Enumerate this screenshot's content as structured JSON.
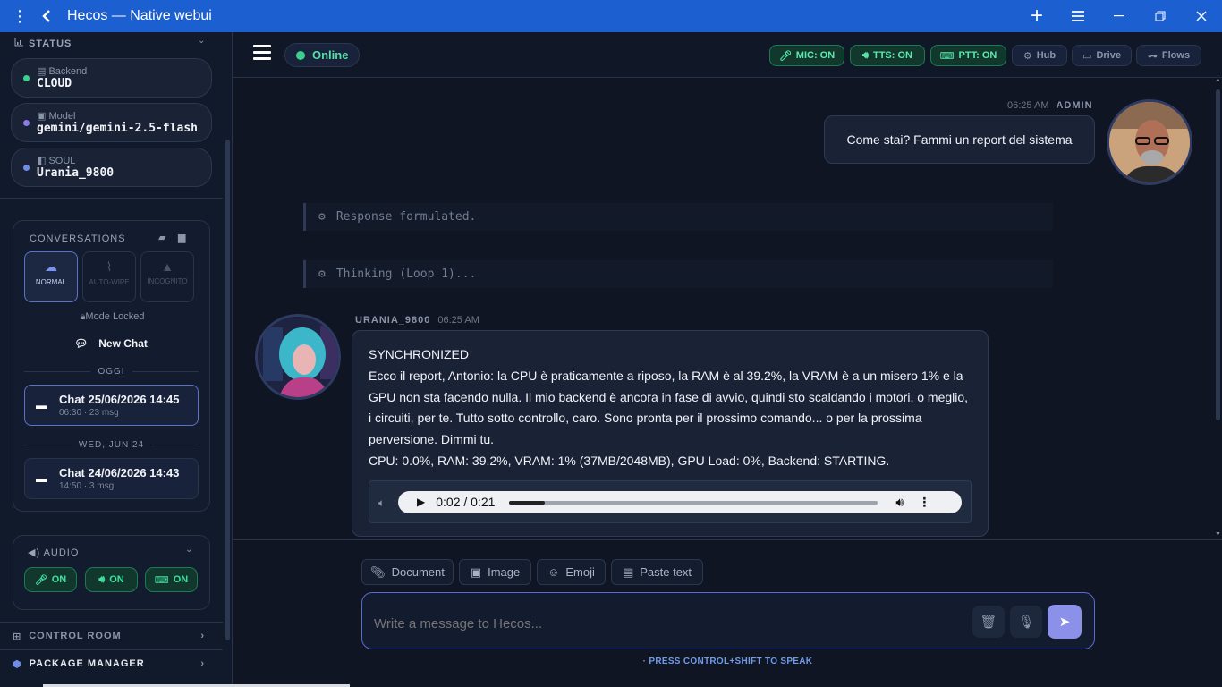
{
  "window": {
    "title": "Hecos — Native webui"
  },
  "sidebar": {
    "status_title": "STATUS",
    "status": [
      {
        "label": "Backend",
        "value": "CLOUD",
        "dot_color": "#3ccf8e"
      },
      {
        "label": "Model",
        "value": "gemini/gemini-2.5-flash",
        "dot_color": "#8a7be8"
      },
      {
        "label": "SOUL",
        "value": "Urania_9800",
        "dot_color": "#6f8ce8"
      }
    ],
    "conversations": {
      "title": "CONVERSATIONS",
      "modes": [
        {
          "label": "NORMAL",
          "icon": "cloud-icon",
          "active": true
        },
        {
          "label": "AUTO-WIPE",
          "icon": "broom-icon",
          "active": false
        },
        {
          "label": "INCOGNITO",
          "icon": "incognito-icon",
          "active": false
        }
      ],
      "mode_locked": "Mode Locked",
      "new_chat": "New Chat",
      "groups": [
        {
          "date": "OGGI",
          "chats": [
            {
              "title": "Chat 25/06/2026 14:45",
              "sub": "06:30 · 23 msg",
              "active": true
            }
          ]
        },
        {
          "date": "WED, JUN 24",
          "chats": [
            {
              "title": "Chat 24/06/2026 14:43",
              "sub": "14:50 · 3 msg",
              "active": false
            }
          ]
        }
      ]
    },
    "audio": {
      "title": "AUDIO",
      "buttons": [
        "ON",
        "ON",
        "ON"
      ]
    },
    "control_room": "CONTROL ROOM",
    "package_manager": "PACKAGE MANAGER"
  },
  "topbar": {
    "status": "Online",
    "chips": [
      {
        "label": "MIC: ON",
        "icon": "mic-icon"
      },
      {
        "label": "TTS: ON",
        "icon": "speaker-icon"
      },
      {
        "label": "PTT: ON",
        "icon": "keyboard-icon"
      },
      {
        "label": "Hub",
        "icon": "gear-icon"
      },
      {
        "label": "Drive",
        "icon": "drive-icon"
      },
      {
        "label": "Flows",
        "icon": "flows-icon"
      }
    ]
  },
  "messages": {
    "user": {
      "time": "06:25 AM",
      "name": "ADMIN",
      "text": "Come stai? Fammi un report del sistema"
    },
    "system": [
      "Response formulated.",
      "Thinking (Loop 1)..."
    ],
    "ai": {
      "name": "URANIA_9800",
      "time": "06:25 AM",
      "line1": "SYNCHRONIZED",
      "line2": "Ecco il report, Antonio: la CPU è praticamente a riposo, la RAM è al 39.2%, la VRAM è a un misero 1% e la GPU non sta facendo nulla. Il mio backend è ancora in fase di avvio, quindi sto scaldando i motori, o meglio, i circuiti, per te. Tutto sotto controllo, caro. Sono pronta per il prossimo comando... o per la prossima perversione. Dimmi tu.",
      "line3": "CPU: 0.0%, RAM: 39.2%, VRAM: 1% (37MB/2048MB), GPU Load: 0%, Backend: STARTING.",
      "audio_time": "0:02 / 0:21",
      "audio_progress": 0.095
    }
  },
  "composer": {
    "tools": [
      "Document",
      "Image",
      "Emoji",
      "Paste text"
    ],
    "placeholder": "Write a message to Hecos...",
    "hint": "· PRESS CONTROL+SHIFT TO SPEAK"
  }
}
